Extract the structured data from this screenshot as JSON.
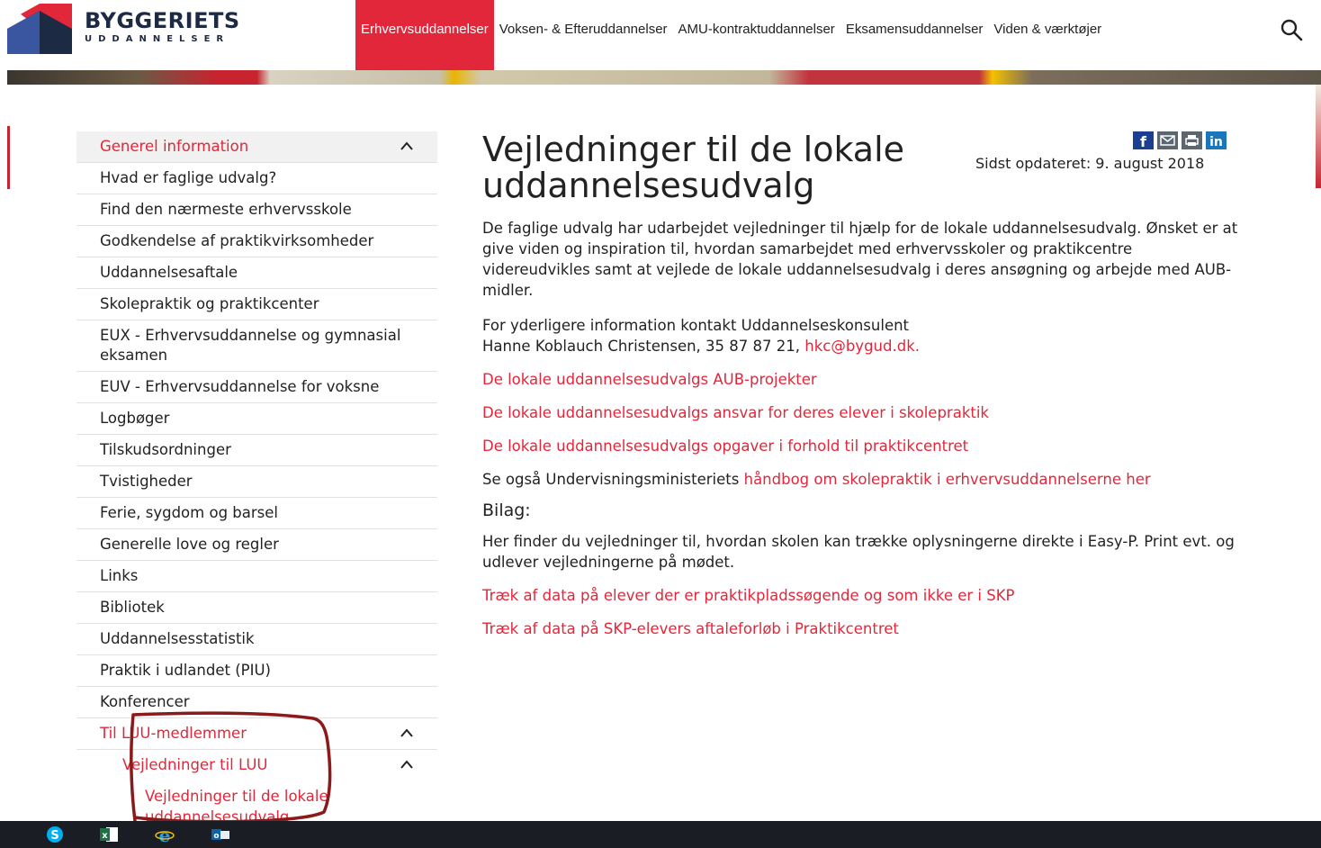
{
  "header": {
    "logo_title": "BYGGERIETS",
    "logo_sub": "UDDANNELSER",
    "nav": [
      {
        "label": "Erhvervsuddannelser",
        "active": true
      },
      {
        "label": "Voksen- & Efteruddannelser",
        "active": false
      },
      {
        "label": "AMU-kontraktuddannelser",
        "active": false
      },
      {
        "label": "Eksamensuddannelser",
        "active": false
      },
      {
        "label": "Viden & værktøjer",
        "active": false
      }
    ],
    "search_icon": "search-icon"
  },
  "sidebar": {
    "section_title": "Generel information",
    "items": [
      "Hvad er faglige udvalg?",
      "Find den nærmeste erhvervsskole",
      "Godkendelse af praktikvirksomheder",
      "Uddannelsesaftale",
      "Skolepraktik og praktikcenter",
      "EUX - Erhvervsuddannelse og gymnasial eksamen",
      "EUV - Erhvervsuddannelse for voksne",
      "Logbøger",
      "Tilskudsordninger",
      "Tvistigheder",
      "Ferie, sygdom og barsel",
      "Generelle love og regler",
      "Links",
      "Bibliotek",
      "Uddannelsesstatistik",
      "Praktik i udlandet (PIU)",
      "Konferencer"
    ],
    "luu_section": "Til LUU-medlemmer",
    "luu_sub": "Vejledninger til LUU",
    "luu_current": "Vejledninger til de lokale uddannelsesudvalg"
  },
  "main": {
    "title": "Vejledninger til de lokale uddannelsesudvalg",
    "updated": "Sidst opdateret: 9. august 2018",
    "intro": "De faglige udvalg har udarbejdet vejledninger til hjælp for de lokale uddannelsesudvalg. Ønsket er at give viden og inspiration til, hvordan samarbejdet med erhvervsskoler og praktikcentre videreudvikles samt at vejlede de lokale uddannelsesudvalg i deres ansøgning og arbejde med AUB-midler.",
    "contact_line1": "For yderligere information kontakt Uddannelseskonsulent",
    "contact_line2": "Hanne Koblauch Christensen, 35 87 87 21, ",
    "contact_email": "hkc@bygud.dk.",
    "links": [
      "De lokale uddannelsesudvalgs AUB-projekter",
      "De lokale uddannelsesudvalgs ansvar for deres elever i skolepraktik",
      "De lokale uddannelsesudvalgs opgaver i forhold til praktikcentret"
    ],
    "see_also_prefix": "Se også Undervisningsministeriets ",
    "see_also_link": "håndbog om skolepraktik i erhvervsuddannelserne her",
    "bilag_title": "Bilag:",
    "bilag_text": "Her finder du vejledninger til, hvordan skolen kan trække oplysningerne direkte i Easy-P. Print evt. og udlever vejledningerne på mødet.",
    "bilag_links": [
      "Træk af data på elever der er praktikpladssøgende og som ikke er i SKP",
      "Træk af data på SKP-elevers aftaleforløb i Praktikcentret"
    ]
  },
  "share_icons": [
    "facebook-icon",
    "email-icon",
    "print-icon",
    "linkedin-icon"
  ],
  "taskbar_icons": [
    "skype-icon",
    "excel-icon",
    "internet-explorer-icon",
    "outlook-icon"
  ],
  "colors": {
    "accent": "#e3273a",
    "navy": "#1d2a44",
    "annotation": "#8b1a1a"
  }
}
